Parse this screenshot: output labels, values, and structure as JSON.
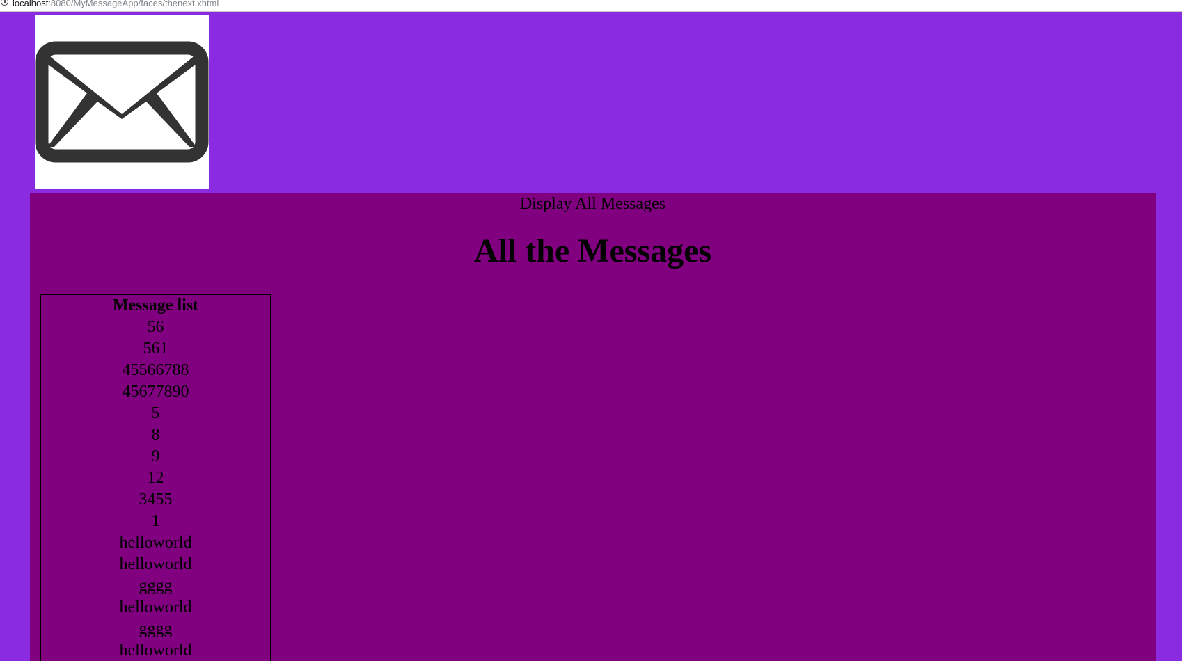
{
  "browser": {
    "url_host": "localhost",
    "url_path": ":8080/MyMessageApp/faces/thenext.xhtml"
  },
  "logo": {
    "icon": "envelope-icon",
    "colors": {
      "background": "#ffffff",
      "stroke": "#333333"
    }
  },
  "panel": {
    "heading": "Display All Messages",
    "title": "All the Messages"
  },
  "message_table": {
    "header": "Message list",
    "rows": [
      "56",
      "561",
      "45566788",
      "45677890",
      "5",
      "8",
      "9",
      "12",
      "3455",
      "1",
      "helloworld",
      "helloworld",
      "gggg",
      "helloworld",
      "gggg",
      "helloworld"
    ]
  },
  "colors": {
    "page_background": "#8a2be2",
    "panel_background": "#800080"
  }
}
